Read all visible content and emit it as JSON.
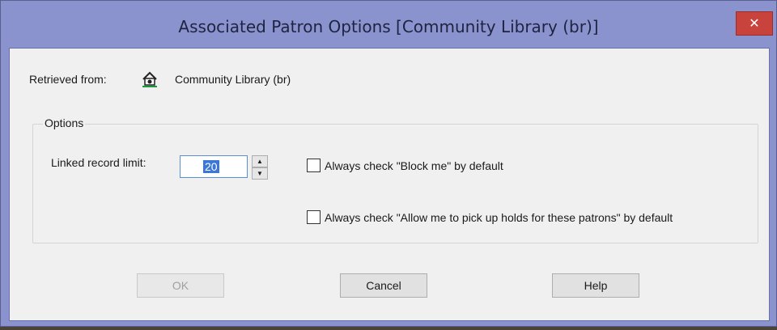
{
  "window": {
    "title": "Associated Patron Options [Community Library  (br)]",
    "close_label": "✕"
  },
  "retrieved": {
    "label": "Retrieved from:",
    "icon": "library-home-icon",
    "value": "Community Library  (br)"
  },
  "options": {
    "group_label": "Options",
    "limit_label": "Linked record limit:",
    "limit_value": "20",
    "checkboxes": [
      {
        "label": "Always check \"Block me\" by default",
        "checked": false
      },
      {
        "label": "Always check \"Allow me to pick up holds for these patrons\" by default",
        "checked": false
      }
    ]
  },
  "buttons": {
    "ok": "OK",
    "cancel": "Cancel",
    "help": "Help"
  },
  "colors": {
    "titlebar": "#8b93cf",
    "close": "#c8433b",
    "client": "#f0f0f0",
    "selection": "#3b77d8"
  }
}
